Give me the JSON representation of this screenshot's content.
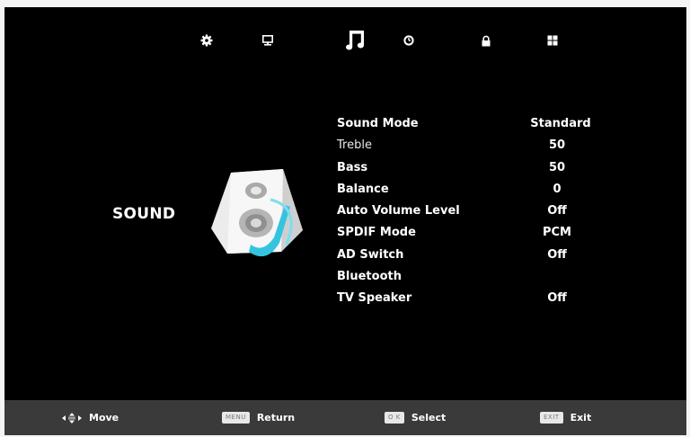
{
  "tabs": [
    {
      "icon": "gear-icon"
    },
    {
      "icon": "monitor-icon"
    },
    {
      "icon": "music-note-icon",
      "active": true
    },
    {
      "icon": "clock-icon"
    },
    {
      "icon": "lock-icon"
    },
    {
      "icon": "grid-icon"
    }
  ],
  "section": {
    "title": "SOUND",
    "icon": "speaker-icon"
  },
  "menu": {
    "items": [
      {
        "label": "Sound Mode",
        "value": "Standard"
      },
      {
        "label": "Treble",
        "value": "50"
      },
      {
        "label": "Bass",
        "value": "50"
      },
      {
        "label": "Balance",
        "value": "0"
      },
      {
        "label": "Auto Volume Level",
        "value": "Off"
      },
      {
        "label": "SPDIF Mode",
        "value": "PCM"
      },
      {
        "label": "AD Switch",
        "value": "Off"
      },
      {
        "label": "Bluetooth",
        "value": ""
      },
      {
        "label": "TV Speaker",
        "value": "Off"
      }
    ]
  },
  "footer": {
    "move": {
      "icon": "arrows-icon",
      "label": "Move"
    },
    "return": {
      "key": "MENU",
      "label": "Return"
    },
    "select": {
      "key": "O K",
      "label": "Select"
    },
    "exit": {
      "key": "EXIT",
      "label": "Exit"
    }
  },
  "colors": {
    "background": "#000000",
    "text": "#ffffff",
    "footer": "#3a3a3a",
    "accent": "#35c4e0"
  }
}
